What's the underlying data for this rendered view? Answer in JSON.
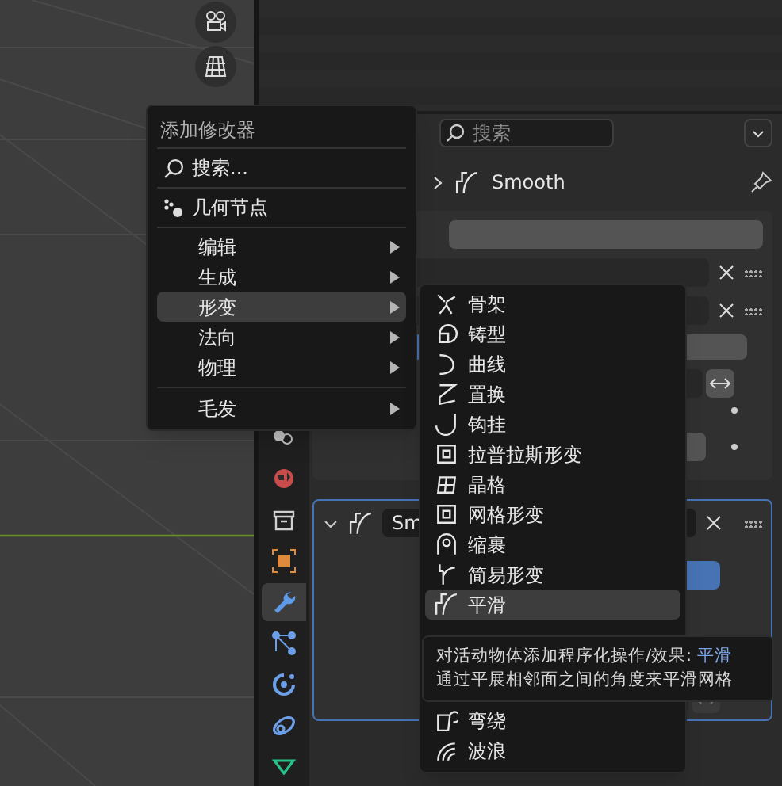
{
  "properties": {
    "search": {
      "placeholder": "搜索"
    },
    "breadcrumb": "Smooth",
    "tabs": [
      {
        "kind": "scene",
        "selected": false
      },
      {
        "kind": "world",
        "selected": false
      },
      {
        "kind": "collection",
        "selected": false
      },
      {
        "kind": "object",
        "selected": false
      },
      {
        "kind": "modifier",
        "selected": true
      },
      {
        "kind": "particles",
        "selected": false
      },
      {
        "kind": "physics",
        "selected": false
      },
      {
        "kind": "constraint",
        "selected": false
      },
      {
        "kind": "data",
        "selected": false
      }
    ],
    "modifier": {
      "name": "Sm",
      "expanded": true
    }
  },
  "add_menu": {
    "title": "添加修改器",
    "search": "搜索...",
    "geometry_nodes": "几何节点",
    "categories": [
      {
        "label": "编辑",
        "selected": false
      },
      {
        "label": "生成",
        "selected": false
      },
      {
        "label": "形变",
        "selected": true
      },
      {
        "label": "法向",
        "selected": false
      },
      {
        "label": "物理",
        "selected": false
      }
    ],
    "more_categories": [
      {
        "label": "毛发",
        "selected": false
      }
    ]
  },
  "deform_menu": {
    "items": [
      {
        "label": "骨架",
        "kind": "armature",
        "selected": false
      },
      {
        "label": "铸型",
        "kind": "cast",
        "selected": false
      },
      {
        "label": "曲线",
        "kind": "curve",
        "selected": false
      },
      {
        "label": "置换",
        "kind": "displace",
        "selected": false
      },
      {
        "label": "钩挂",
        "kind": "hook",
        "selected": false
      },
      {
        "label": "拉普拉斯形变",
        "kind": "frame",
        "selected": false
      },
      {
        "label": "晶格",
        "kind": "lattice",
        "selected": false
      },
      {
        "label": "网格形变",
        "kind": "frame",
        "selected": false
      },
      {
        "label": "缩裹",
        "kind": "shrinkwrap",
        "selected": false
      },
      {
        "label": "简易形变",
        "kind": "simple",
        "selected": false
      },
      {
        "label": "平滑",
        "kind": "smooth",
        "selected": true
      }
    ],
    "bottom_items": [
      {
        "label": "弯绕",
        "kind": "warp",
        "selected": false
      },
      {
        "label": "波浪",
        "kind": "wave",
        "selected": false
      }
    ]
  },
  "tooltip": {
    "text": "对活动物体添加程序化操作/效果: ",
    "highlight": "平滑",
    "description": "通过平展相邻面之间的角度来平滑网格"
  }
}
